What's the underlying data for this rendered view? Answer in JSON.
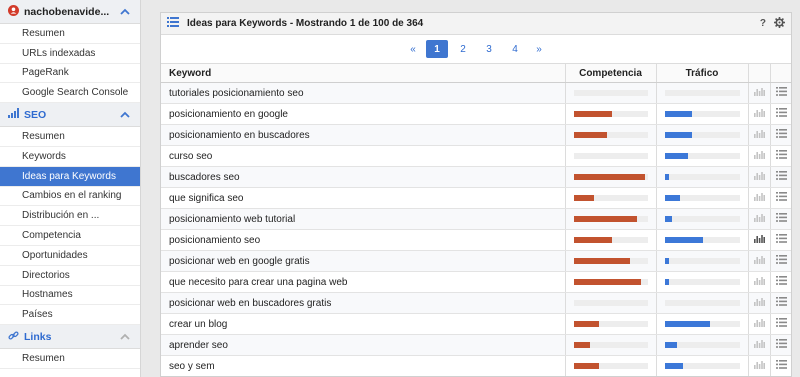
{
  "colors": {
    "accent": "#3f76d0",
    "competencia": "#c2532f",
    "trafico": "#3c78d8"
  },
  "sidebar": {
    "user": {
      "label": "nachobenavide...",
      "icon": "user-icon"
    },
    "group1": [
      {
        "label": "Resumen"
      },
      {
        "label": "URLs indexadas"
      },
      {
        "label": "PageRank"
      },
      {
        "label": "Google Search Console"
      }
    ],
    "seo": {
      "label": "SEO",
      "icon": "bar-chart-icon"
    },
    "group2": [
      {
        "label": "Resumen"
      },
      {
        "label": "Keywords"
      },
      {
        "label": "Ideas para Keywords"
      },
      {
        "label": "Cambios en el ranking"
      },
      {
        "label": "Distribución en ..."
      },
      {
        "label": "Competencia"
      },
      {
        "label": "Oportunidades"
      },
      {
        "label": "Directorios"
      },
      {
        "label": "Hostnames"
      },
      {
        "label": "Países"
      }
    ],
    "links": {
      "label": "Links",
      "icon": "link-icon"
    },
    "group3": [
      {
        "label": "Resumen"
      }
    ]
  },
  "panel": {
    "title": "Ideas para Keywords - Mostrando 1 de 100 de 364",
    "help": "?",
    "pagination": {
      "prev": "«",
      "pages": [
        "1",
        "2",
        "3",
        "4"
      ],
      "current": "1",
      "next": "»"
    },
    "columns": {
      "keyword": "Keyword",
      "competencia": "Competencia",
      "trafico": "Tráfico"
    },
    "rows": [
      {
        "keyword": "tutoriales posicionamiento seo",
        "competencia": 0,
        "trafico": 0,
        "chart_active": false
      },
      {
        "keyword": "posicionamiento en google",
        "competencia": 0.52,
        "trafico": 0.36,
        "chart_active": false
      },
      {
        "keyword": "posicionamiento en buscadores",
        "competencia": 0.45,
        "trafico": 0.36,
        "chart_active": false
      },
      {
        "keyword": "curso seo",
        "competencia": 0,
        "trafico": 0.31,
        "chart_active": false
      },
      {
        "keyword": "buscadores seo",
        "competencia": 0.97,
        "trafico": 0.06,
        "chart_active": false
      },
      {
        "keyword": "que significa seo",
        "competencia": 0.28,
        "trafico": 0.2,
        "chart_active": false
      },
      {
        "keyword": "posicionamiento web tutorial",
        "competencia": 0.86,
        "trafico": 0.1,
        "chart_active": false
      },
      {
        "keyword": "posicionamiento seo",
        "competencia": 0.52,
        "trafico": 0.51,
        "chart_active": true
      },
      {
        "keyword": "posicionar web en google gratis",
        "competencia": 0.76,
        "trafico": 0.06,
        "chart_active": false
      },
      {
        "keyword": "que necesito para crear una pagina web",
        "competencia": 0.91,
        "trafico": 0.06,
        "chart_active": false
      },
      {
        "keyword": "posicionar web en buscadores gratis",
        "competencia": 0,
        "trafico": 0,
        "chart_active": false
      },
      {
        "keyword": "crear un blog",
        "competencia": 0.35,
        "trafico": 0.6,
        "chart_active": false
      },
      {
        "keyword": "aprender seo",
        "competencia": 0.22,
        "trafico": 0.16,
        "chart_active": false
      },
      {
        "keyword": "seo y sem",
        "competencia": 0.35,
        "trafico": 0.25,
        "chart_active": false
      }
    ]
  }
}
